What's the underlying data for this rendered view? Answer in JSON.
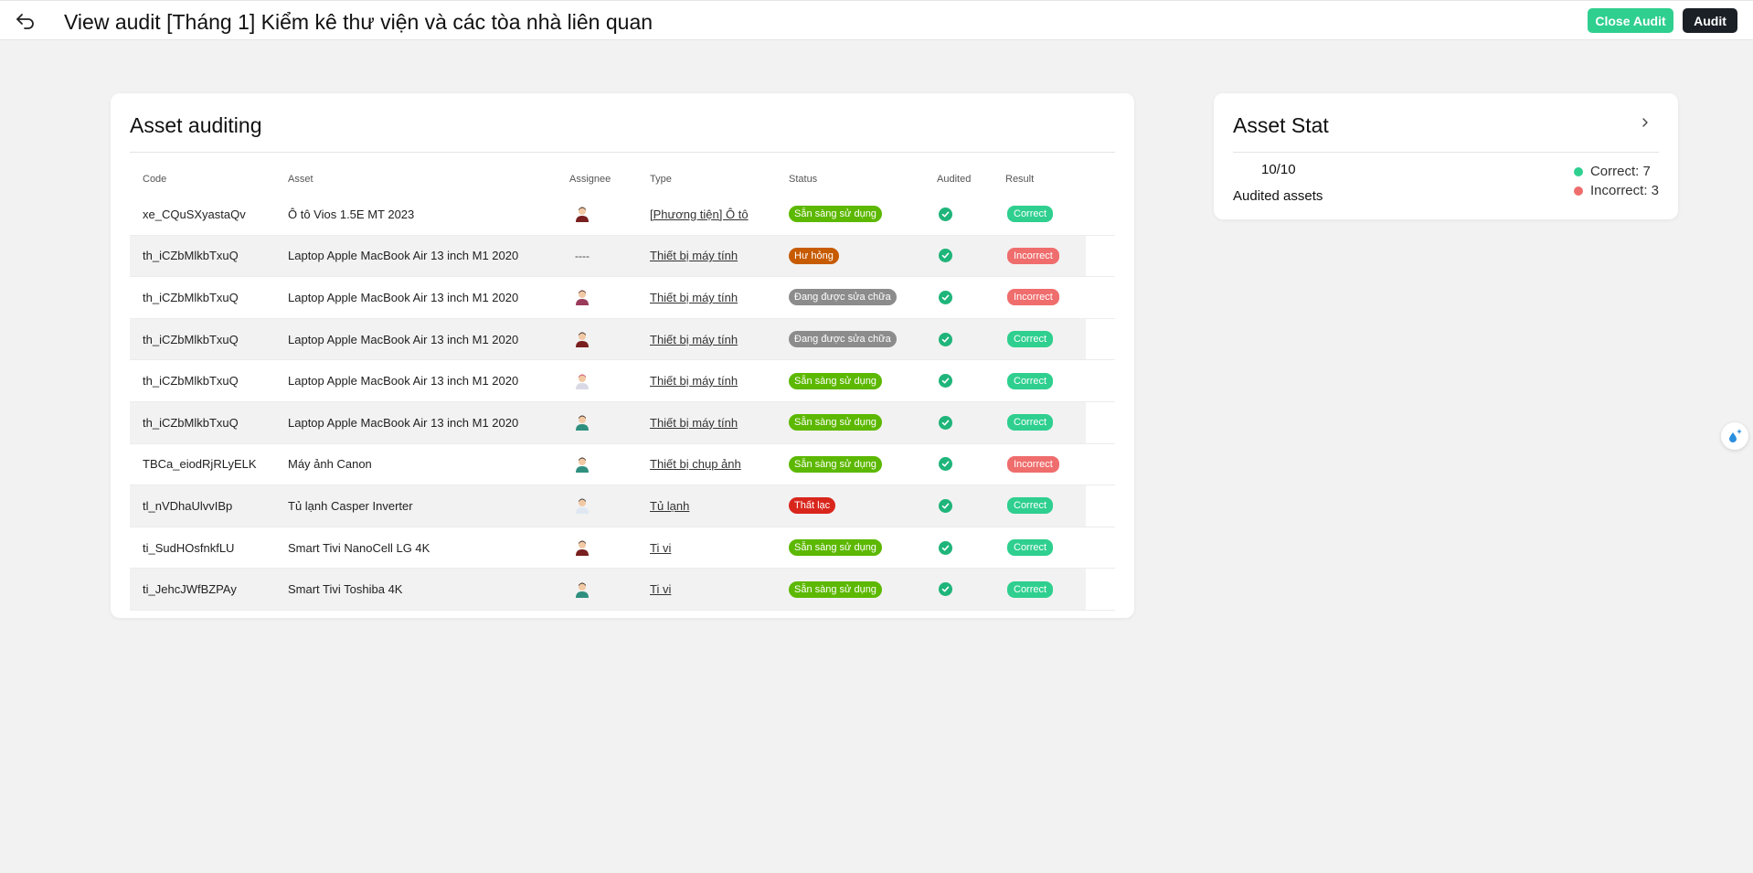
{
  "header": {
    "title": "View audit [Tháng 1] Kiểm kê thư viện và các tòa nhà liên quan",
    "close_audit_label": "Close Audit",
    "audit_label": "Audit"
  },
  "audit_card": {
    "title": "Asset auditing",
    "columns": [
      "Code",
      "Asset",
      "Assignee",
      "Type",
      "Status",
      "Audited",
      "Result"
    ]
  },
  "rows": [
    {
      "code": "xe_CQuSXyastaQv",
      "asset": "Ô tô Vios 1.5E MT 2023",
      "assignee": "avatar-man-dark",
      "type": "[Phương tiện] Ô tô",
      "status": "Sẵn sàng sử dụng",
      "status_color": "#5cb800",
      "result": "Correct",
      "result_kind": "ok"
    },
    {
      "code": "th_iCZbMlkbTxuQ",
      "asset": "Laptop Apple MacBook Air 13 inch M1 2020",
      "assignee": "----",
      "type": "Thiết bị máy tính",
      "status": "Hư hỏng",
      "status_color": "#c75b00",
      "result": "Incorrect",
      "result_kind": "bad"
    },
    {
      "code": "th_iCZbMlkbTxuQ",
      "asset": "Laptop Apple MacBook Air 13 inch M1 2020",
      "assignee": "avatar-woman",
      "type": "Thiết bị máy tính",
      "status": "Đang được sửa chữa",
      "status_color": "#8c8c8c",
      "result": "Incorrect",
      "result_kind": "bad"
    },
    {
      "code": "th_iCZbMlkbTxuQ",
      "asset": "Laptop Apple MacBook Air 13 inch M1 2020",
      "assignee": "avatar-man-dark",
      "type": "Thiết bị máy tính",
      "status": "Đang được sửa chữa",
      "status_color": "#8c8c8c",
      "result": "Correct",
      "result_kind": "ok"
    },
    {
      "code": "th_iCZbMlkbTxuQ",
      "asset": "Laptop Apple MacBook Air 13 inch M1 2020",
      "assignee": "avatar-nurse",
      "type": "Thiết bị máy tính",
      "status": "Sẵn sàng sử dụng",
      "status_color": "#5cb800",
      "result": "Correct",
      "result_kind": "ok"
    },
    {
      "code": "th_iCZbMlkbTxuQ",
      "asset": "Laptop Apple MacBook Air 13 inch M1 2020",
      "assignee": "avatar-man-teal",
      "type": "Thiết bị máy tính",
      "status": "Sẵn sàng sử dụng",
      "status_color": "#5cb800",
      "result": "Correct",
      "result_kind": "ok"
    },
    {
      "code": "TBCa_eiodRjRLyELK",
      "asset": "Máy ảnh Canon",
      "assignee": "avatar-man-teal",
      "type": "Thiết bị chụp ảnh",
      "status": "Sẵn sàng sử dụng",
      "status_color": "#5cb800",
      "result": "Incorrect",
      "result_kind": "bad"
    },
    {
      "code": "tl_nVDhaUlvvIBp",
      "asset": "Tủ lạnh Casper Inverter",
      "assignee": "avatar-doctor",
      "type": "Tủ lạnh",
      "status": "Thất lạc",
      "status_color": "#d9261c",
      "result": "Correct",
      "result_kind": "ok"
    },
    {
      "code": "ti_SudHOsfnkfLU",
      "asset": "Smart Tivi NanoCell LG 4K",
      "assignee": "avatar-man-dark",
      "type": "Ti vi",
      "status": "Sẵn sàng sử dụng",
      "status_color": "#5cb800",
      "result": "Correct",
      "result_kind": "ok"
    },
    {
      "code": "ti_JehcJWfBZPAy",
      "asset": "Smart Tivi Toshiba 4K",
      "assignee": "avatar-man-teal",
      "type": "Ti vi",
      "status": "Sẵn sàng sử dụng",
      "status_color": "#5cb800",
      "result": "Correct",
      "result_kind": "ok"
    }
  ],
  "stat_card": {
    "title": "Asset Stat",
    "count": "10/10",
    "count_label": "Audited assets",
    "correct_label": "Correct: 7",
    "incorrect_label": "Incorrect: 3",
    "correct_color": "#2fcf8f",
    "incorrect_color": "#ef6d6d"
  },
  "icons": {
    "back": "back-arrow-icon",
    "audited": "check-circle-icon",
    "stat_expand": "chevron-right-icon",
    "floating": "sparkle-drop-icon"
  }
}
